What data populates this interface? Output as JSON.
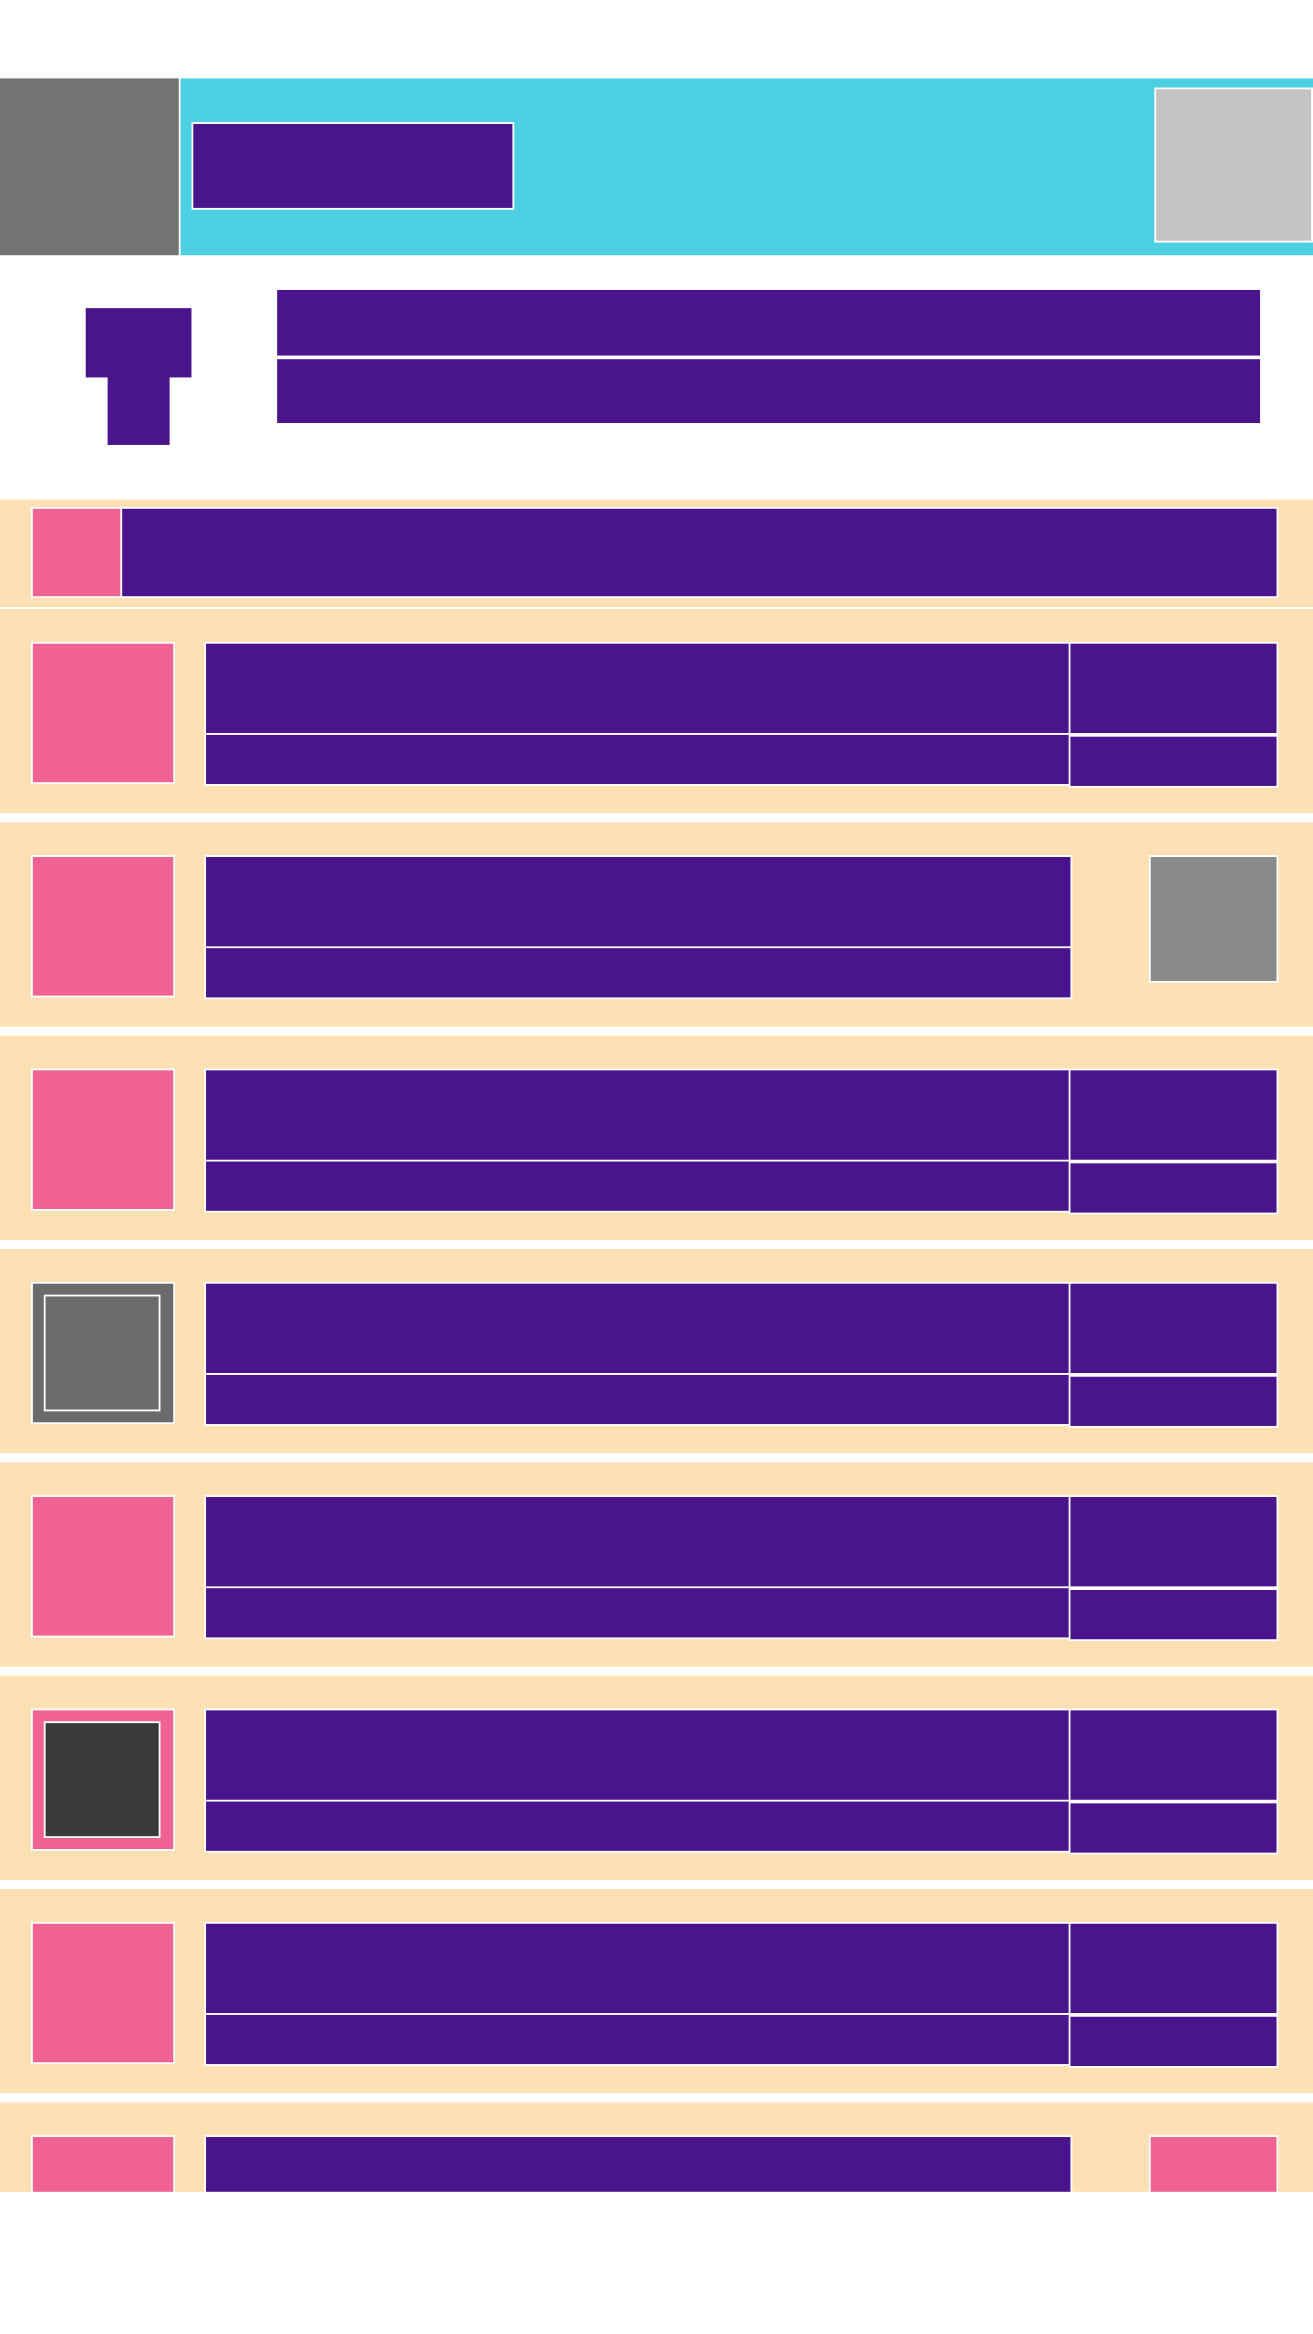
{
  "colors": {
    "app_bar": "#4dd0e1",
    "nav_button": "#737373",
    "action_button": "#c4c4c4",
    "text_block": "#4a148c",
    "row_background": "#fde0b3",
    "thumbnail": "#f06292",
    "gray_square": "#8a8a8a",
    "dark_thumbnail": "#3a3a3a",
    "gray_thumbnail": "#6b6b6b"
  },
  "app_bar": {
    "nav_icon": "menu-icon",
    "title": "",
    "action_icon": "action-icon"
  },
  "header": {
    "label_a": "",
    "label_b": "",
    "title": "",
    "subtitle": ""
  },
  "summary": {
    "icon": "item-icon",
    "text": ""
  },
  "rows": [
    {
      "title": "",
      "subtitle": "",
      "meta_top": "",
      "meta_bottom": ""
    },
    {
      "title": "",
      "subtitle": "",
      "trailing": "gray-square"
    },
    {
      "title": "",
      "subtitle": "",
      "meta_top": "",
      "meta_bottom": ""
    },
    {
      "title": "",
      "subtitle": "",
      "meta_top": "",
      "meta_bottom": "",
      "thumbnail": "gray"
    },
    {
      "title": "",
      "subtitle": "",
      "meta_top": "",
      "meta_bottom": ""
    },
    {
      "title": "",
      "subtitle": "",
      "meta_top": "",
      "meta_bottom": "",
      "thumbnail": "dark"
    },
    {
      "title": "",
      "subtitle": "",
      "meta_top": "",
      "meta_bottom": ""
    },
    {
      "title": "",
      "trailing": "pink-square"
    }
  ]
}
